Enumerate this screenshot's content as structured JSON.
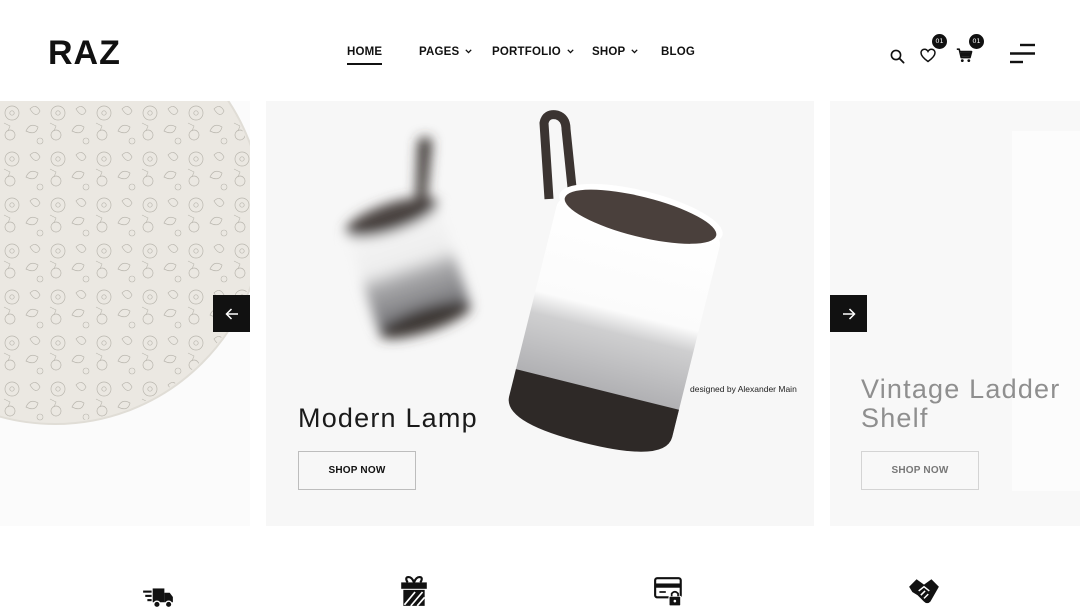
{
  "brand": {
    "logo": "RAZ"
  },
  "nav": {
    "items": [
      {
        "label": "HOME",
        "active": true,
        "dropdown": false
      },
      {
        "label": "PAGES",
        "active": false,
        "dropdown": true
      },
      {
        "label": "PORTFOLIO",
        "active": false,
        "dropdown": true
      },
      {
        "label": "SHOP",
        "active": false,
        "dropdown": true
      },
      {
        "label": "BLOG",
        "active": false,
        "dropdown": false
      }
    ]
  },
  "header_icons": {
    "search": "search-icon",
    "wishlist": {
      "icon": "heart-icon",
      "count": "01"
    },
    "cart": {
      "icon": "cart-icon",
      "count": "01"
    },
    "menu": "hamburger-menu-icon"
  },
  "slider": {
    "center": {
      "title": "Modern Lamp",
      "button": "SHOP NOW",
      "credit": "designed by Alexander Main"
    },
    "right": {
      "title_line1": "Vintage Ladder",
      "title_line2": "Shelf",
      "button": "SHOP NOW"
    },
    "prev_icon": "arrow-left-icon",
    "next_icon": "arrow-right-icon"
  },
  "features": [
    {
      "icon": "fast-delivery-truck-icon"
    },
    {
      "icon": "gift-box-icon"
    },
    {
      "icon": "secure-payment-card-icon"
    },
    {
      "icon": "handshake-icon"
    }
  ],
  "colors": {
    "accent": "#111111",
    "slide_bg": "#f7f7f7",
    "muted_text": "#8f8f8f"
  }
}
